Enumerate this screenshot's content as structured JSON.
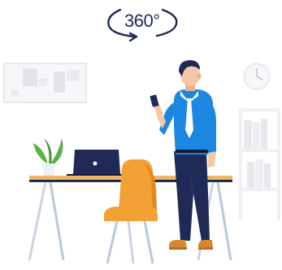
{
  "badge": {
    "label": "360°"
  },
  "colors": {
    "navy": "#1f2a56",
    "shirt_blue": "#1b87e0",
    "desk_top": "#f0b765",
    "desk_legs": "#b9c7dc",
    "chair_orange": "#f2a234",
    "chair_dark": "#e0891f",
    "wall_gray": "#f1f2f4",
    "panel_gray": "#e3e5ea",
    "skin": "#f4c8a4",
    "plant_green": "#5fb04a",
    "shoe_brown": "#d5882f"
  },
  "icons": {
    "badge": "rotate-360-icon",
    "clock": "wall-clock-icon",
    "laptop": "laptop-icon",
    "phone": "smartphone-icon"
  }
}
